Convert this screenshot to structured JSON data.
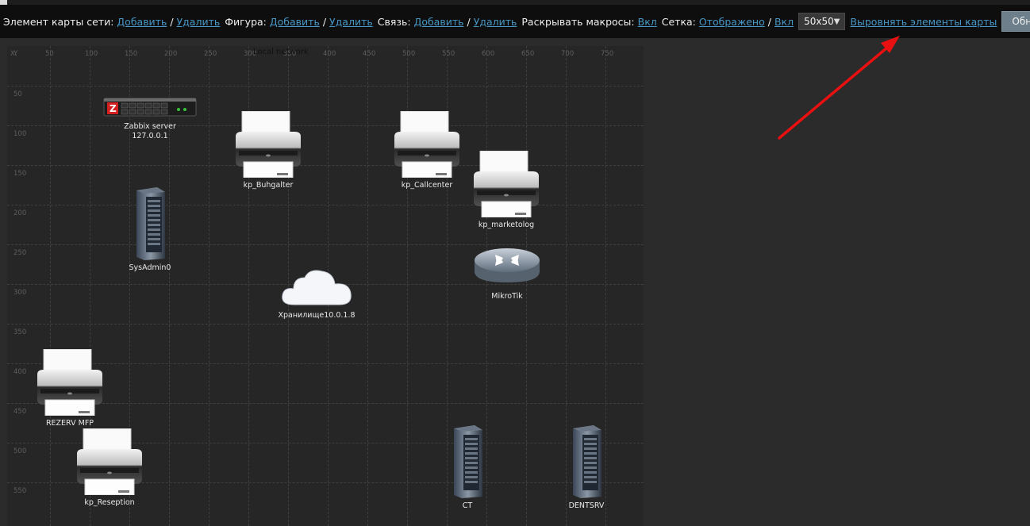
{
  "toolbar": {
    "map_element_label": "Элемент карты сети:",
    "shape_label": "Фигура:",
    "link_label": "Связь:",
    "expand_macros_label": "Раскрывать макросы:",
    "grid_label": "Сетка:",
    "add": "Добавить",
    "remove": "Удалить",
    "on": "Вкл",
    "shown": "Отображено",
    "grid_size": "50x50",
    "align_link": "Выровнять элементы карты",
    "update_button": "Обновить",
    "slash": "/"
  },
  "map": {
    "title": "Local network",
    "x_axis_label": "X:",
    "y_axis_label": "Y",
    "x_ticks": [
      "50",
      "100",
      "150",
      "200",
      "250",
      "300",
      "350",
      "400",
      "450",
      "500",
      "550",
      "600",
      "650",
      "700",
      "750"
    ],
    "y_ticks": [
      "50",
      "100",
      "150",
      "200",
      "250",
      "300",
      "350",
      "400",
      "450",
      "500",
      "550"
    ]
  },
  "nodes": {
    "zabbix": {
      "name": "Zabbix server",
      "ip": "127.0.0.1",
      "icon": "zabbix-server-icon"
    },
    "buhgalter": {
      "name": "kp_Buhgalter",
      "icon": "printer-icon"
    },
    "callcenter": {
      "name": "kp_Callcenter",
      "icon": "printer-icon"
    },
    "marketolog": {
      "name": "kp_marketolog",
      "icon": "printer-icon"
    },
    "sysadmin": {
      "name": "SysAdmin0",
      "icon": "server-tower-icon"
    },
    "mikrotik": {
      "name": "MikroTik",
      "icon": "router-icon"
    },
    "storage": {
      "name": "Хранилище10.0.1.8",
      "icon": "cloud-icon"
    },
    "rezerv": {
      "name": "REZERV MFP",
      "icon": "printer-icon"
    },
    "reseption": {
      "name": "kp_Reseption",
      "icon": "printer-icon"
    },
    "ct": {
      "name": "CT",
      "icon": "server-tower-icon"
    },
    "dentsrv": {
      "name": "DENTSRV",
      "icon": "server-tower-icon"
    }
  },
  "colors": {
    "link": "#4796c4",
    "arrow": "#e81010",
    "toolbar_bg": "#0e0e0e",
    "map_bg": "#262626"
  }
}
